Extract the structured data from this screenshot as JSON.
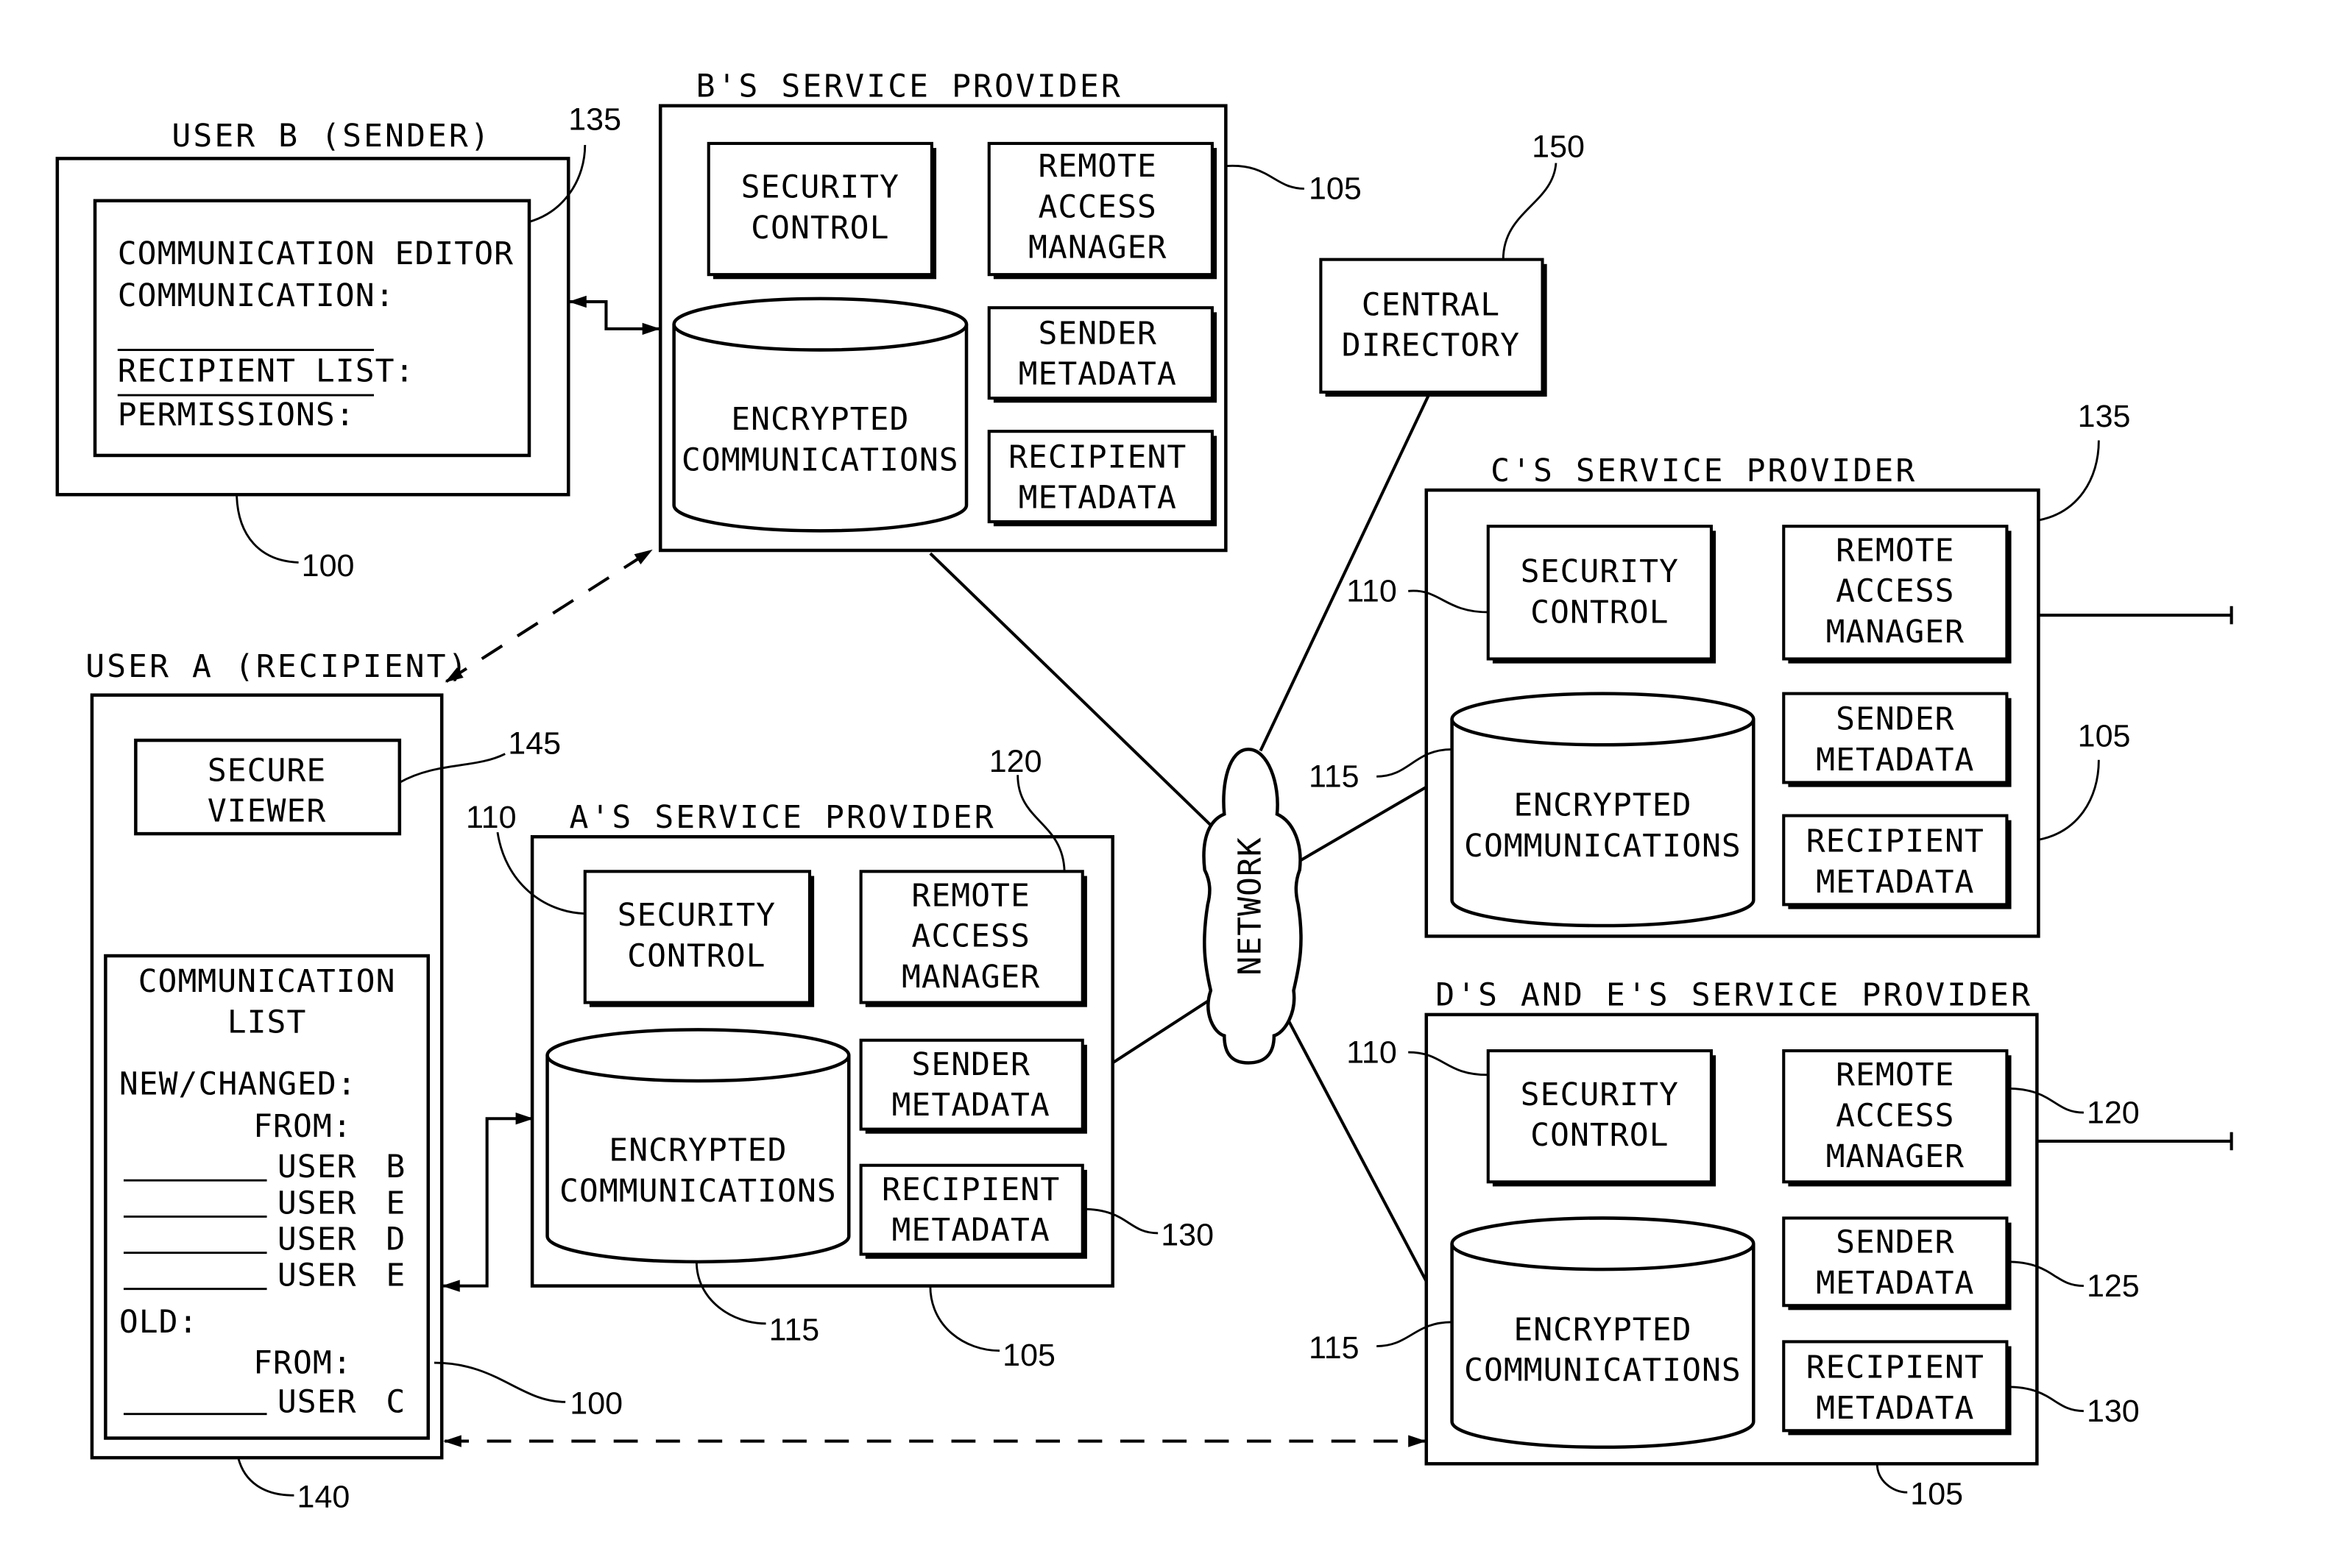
{
  "diagram": {
    "user_b": {
      "title": "USER B (SENDER)",
      "editor_lines": [
        "COMMUNICATION EDITOR",
        "COMMUNICATION:"
      ],
      "recipient_list": "RECIPIENT LIST:",
      "permissions": "PERMISSIONS:",
      "ref_editor": "135",
      "ref_device": "100"
    },
    "b_provider": {
      "title": "B'S SERVICE PROVIDER",
      "security_control": [
        "SECURITY",
        "CONTROL"
      ],
      "remote_access_manager": [
        "REMOTE",
        "ACCESS",
        "MANAGER"
      ],
      "sender_metadata": [
        "SENDER",
        "METADATA"
      ],
      "recipient_metadata": [
        "RECIPIENT",
        "METADATA"
      ],
      "encrypted_communications": [
        "ENCRYPTED",
        "COMMUNICATIONS"
      ],
      "ref": "105"
    },
    "central_directory": {
      "label": [
        "CENTRAL",
        "DIRECTORY"
      ],
      "ref": "150"
    },
    "network": {
      "label": "NETWORK"
    },
    "c_provider": {
      "title": "C'S SERVICE PROVIDER",
      "security_control": [
        "SECURITY",
        "CONTROL"
      ],
      "remote_access_manager": [
        "REMOTE",
        "ACCESS",
        "MANAGER"
      ],
      "sender_metadata": [
        "SENDER",
        "METADATA"
      ],
      "recipient_metadata": [
        "RECIPIENT",
        "METADATA"
      ],
      "encrypted_communications": [
        "ENCRYPTED",
        "COMMUNICATIONS"
      ],
      "ref_top": "135",
      "ref_security": "110",
      "ref_storage": "115",
      "ref_box": "105"
    },
    "de_provider": {
      "title": "D'S AND E'S SERVICE PROVIDER",
      "security_control": [
        "SECURITY",
        "CONTROL"
      ],
      "remote_access_manager": [
        "REMOTE",
        "ACCESS",
        "MANAGER"
      ],
      "sender_metadata": [
        "SENDER",
        "METADATA"
      ],
      "recipient_metadata": [
        "RECIPIENT",
        "METADATA"
      ],
      "encrypted_communications": [
        "ENCRYPTED",
        "COMMUNICATIONS"
      ],
      "ref_security": "110",
      "ref_storage": "115",
      "ref_ram": "120",
      "ref_sender": "125",
      "ref_recipient": "130",
      "ref_box": "105"
    },
    "user_a": {
      "title": "USER A (RECIPIENT)",
      "secure_viewer": [
        "SECURE",
        "VIEWER"
      ],
      "comm_list_title": [
        "COMMUNICATION",
        "LIST"
      ],
      "new_changed": "NEW/CHANGED:",
      "from_new": "FROM:",
      "new_items": [
        {
          "user": "USER",
          "id": "B"
        },
        {
          "user": "USER",
          "id": "E"
        },
        {
          "user": "USER",
          "id": "D"
        },
        {
          "user": "USER",
          "id": "E"
        }
      ],
      "old": "OLD:",
      "from_old": "FROM:",
      "old_items": [
        {
          "user": "USER",
          "id": "C"
        }
      ],
      "ref_viewer": "145",
      "ref_list": "140",
      "ref_device": "100"
    },
    "a_provider": {
      "title": "A'S SERVICE PROVIDER",
      "security_control": [
        "SECURITY",
        "CONTROL"
      ],
      "remote_access_manager": [
        "REMOTE",
        "ACCESS",
        "MANAGER"
      ],
      "sender_metadata": [
        "SENDER",
        "METADATA"
      ],
      "recipient_metadata": [
        "RECIPIENT",
        "METADATA"
      ],
      "encrypted_communications": [
        "ENCRYPTED",
        "COMMUNICATIONS"
      ],
      "ref_security": "110",
      "ref_ram": "120",
      "ref_recipient": "130",
      "ref_storage": "115",
      "ref_box": "105"
    }
  }
}
